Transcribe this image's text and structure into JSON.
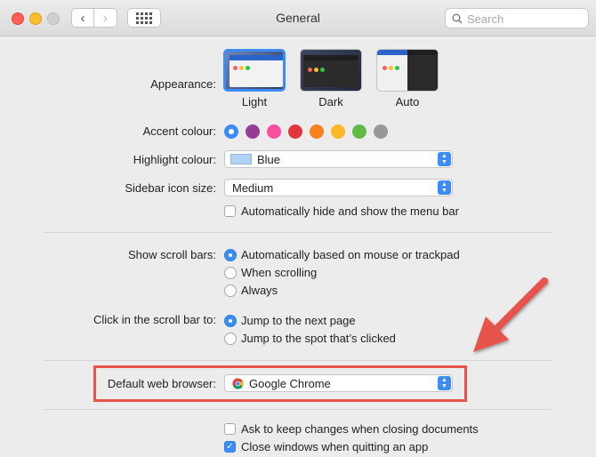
{
  "window": {
    "title": "General"
  },
  "search": {
    "placeholder": "Search"
  },
  "appearance": {
    "label": "Appearance:",
    "options": [
      {
        "name": "Light",
        "selected": true
      },
      {
        "name": "Dark",
        "selected": false
      },
      {
        "name": "Auto",
        "selected": false
      }
    ]
  },
  "accent": {
    "label": "Accent colour:",
    "colors": [
      "#3b8cf7",
      "#953d96",
      "#f74f9e",
      "#e0383e",
      "#f7821b",
      "#fcb827",
      "#62ba46",
      "#989898"
    ],
    "selected_index": 0
  },
  "highlight": {
    "label": "Highlight colour:",
    "value": "Blue",
    "chip_color": "#b3d1f5"
  },
  "sidebar_icon_size": {
    "label": "Sidebar icon size:",
    "value": "Medium"
  },
  "menu_bar": {
    "label": "Automatically hide and show the menu bar",
    "checked": false
  },
  "scroll_bars": {
    "label": "Show scroll bars:",
    "options": [
      {
        "label": "Automatically based on mouse or trackpad",
        "selected": true
      },
      {
        "label": "When scrolling",
        "selected": false
      },
      {
        "label": "Always",
        "selected": false
      }
    ]
  },
  "scroll_click": {
    "label": "Click in the scroll bar to:",
    "options": [
      {
        "label": "Jump to the next page",
        "selected": true
      },
      {
        "label": "Jump to the spot that’s clicked",
        "selected": false
      }
    ]
  },
  "default_browser": {
    "label": "Default web browser:",
    "value": "Google Chrome"
  },
  "ask_keep_changes": {
    "label": "Ask to keep changes when closing documents",
    "checked": false
  },
  "close_windows": {
    "label": "Close windows when quitting an app",
    "checked": true
  },
  "annotation": {
    "color": "#e5534b"
  }
}
